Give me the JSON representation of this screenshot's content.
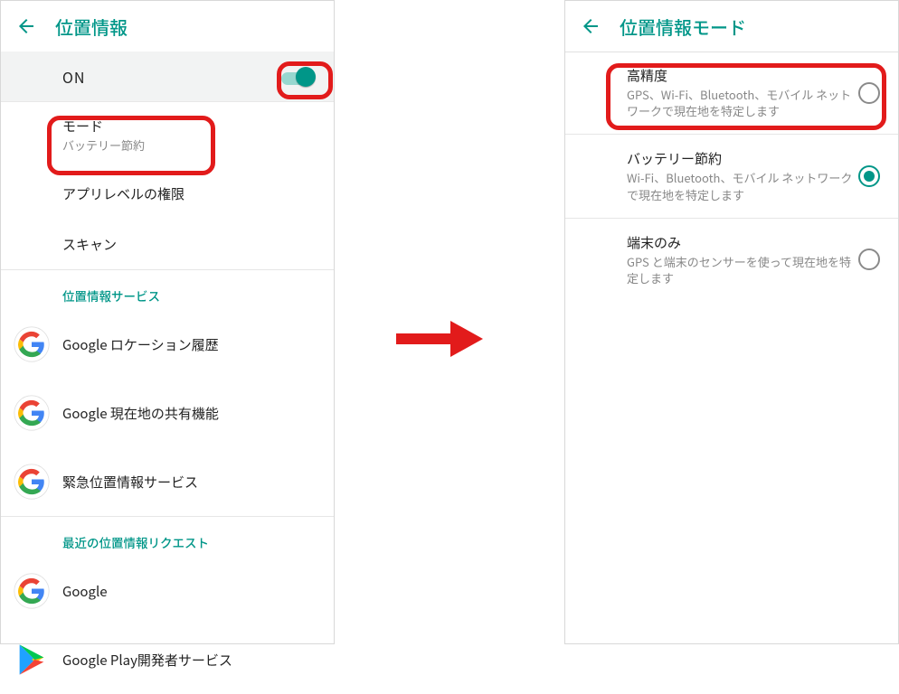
{
  "left": {
    "title": "位置情報",
    "toggle": {
      "label": "ON"
    },
    "items": [
      {
        "primary": "モード",
        "secondary": "バッテリー節約"
      },
      {
        "primary": "アプリレベルの権限"
      },
      {
        "primary": "スキャン"
      }
    ],
    "section1": "位置情報サービス",
    "services": [
      {
        "label": "Google ロケーション履歴",
        "icon": "google"
      },
      {
        "label": "Google 現在地の共有機能",
        "icon": "google"
      },
      {
        "label": "緊急位置情報サービス",
        "icon": "google"
      }
    ],
    "section2": "最近の位置情報リクエスト",
    "recent": [
      {
        "label": "Google",
        "icon": "google"
      },
      {
        "label": "Google Play開発者サービス",
        "icon": "play"
      }
    ]
  },
  "right": {
    "title": "位置情報モード",
    "options": [
      {
        "title": "高精度",
        "desc": "GPS、Wi-Fi、Bluetooth、モバイル ネットワークで現在地を特定します",
        "selected": false
      },
      {
        "title": "バッテリー節約",
        "desc": "Wi-Fi、Bluetooth、モバイル ネットワークで現在地を特定します",
        "selected": true
      },
      {
        "title": "端末のみ",
        "desc": "GPS と端末のセンサーを使って現在地を特定します",
        "selected": false
      }
    ]
  }
}
